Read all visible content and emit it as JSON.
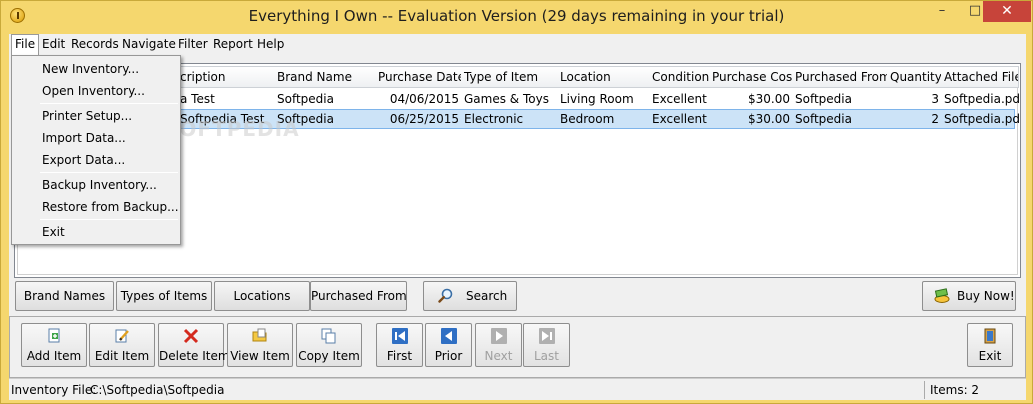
{
  "window": {
    "title": "Everything I Own -- Evaluation Version (29 days remaining in your trial)",
    "minimize": "–",
    "maximize": "□",
    "close": "✕"
  },
  "menubar": {
    "items": [
      "File",
      "Edit",
      "Records",
      "Navigate",
      "Filter",
      "Report",
      "Help"
    ]
  },
  "file_menu": {
    "items": [
      "New Inventory...",
      "Open Inventory...",
      "Printer Setup...",
      "Import Data...",
      "Export Data...",
      "Backup Inventory...",
      "Restore from Backup...",
      "Exit"
    ]
  },
  "grid": {
    "columns": [
      "Description",
      "Brand Name",
      "Purchase Date",
      "Type of Item",
      "Location",
      "Condition",
      "Purchase Cost",
      "Purchased From",
      "Quantity",
      "Attached File"
    ],
    "visible_header_0": "cription",
    "rows": [
      {
        "description": "a Test",
        "brand": "Softpedia",
        "date": "04/06/2015",
        "type": "Games & Toys",
        "location": "Living Room",
        "condition": "Excellent",
        "cost": "$30.00",
        "from": "Softpedia",
        "qty": "3",
        "file": "Softpedia.pdf"
      },
      {
        "description": "Softpedia Test",
        "brand": "Softpedia",
        "date": "06/25/2015",
        "type": "Electronic",
        "location": "Bedroom",
        "condition": "Excellent",
        "cost": "$30.00",
        "from": "Softpedia",
        "qty": "2",
        "file": "Softpedia.pdf"
      }
    ]
  },
  "watermark": "SOFTPEDIA",
  "filter_buttons": {
    "brand_names": "Brand Names",
    "types_of_items": "Types of Items",
    "locations": "Locations",
    "purchased_from": "Purchased From",
    "search": "Search",
    "buy_now": "Buy Now!"
  },
  "toolbar": {
    "add_item": "Add Item",
    "edit_item": "Edit Item",
    "delete_item": "Delete Item",
    "view_item": "View Item",
    "copy_item": "Copy Item",
    "first": "First",
    "prior": "Prior",
    "next": "Next",
    "last": "Last",
    "exit": "Exit"
  },
  "statusbar": {
    "inventory_file_label": "Inventory File:",
    "inventory_file_path": "C:\\Softpedia\\Softpedia",
    "items_count": "Items: 2"
  },
  "colors": {
    "title_bar": "#f5d76e",
    "selection": "#cce3f7",
    "close_button": "#c7443a"
  }
}
